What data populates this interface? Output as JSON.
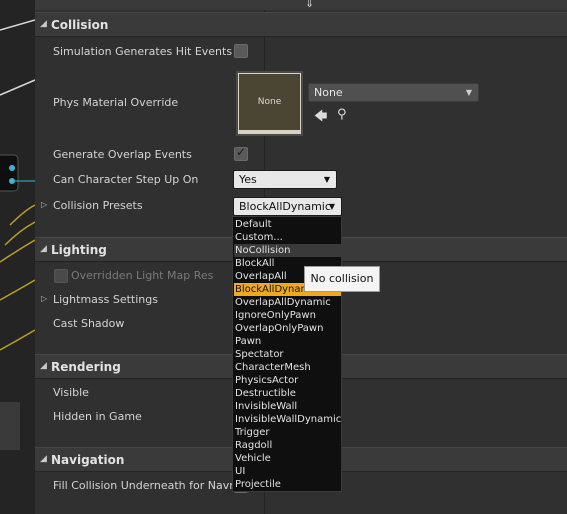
{
  "categories": {
    "collision": "Collision",
    "lighting": "Lighting",
    "rendering": "Rendering",
    "navigation": "Navigation"
  },
  "collision": {
    "sim_hit_events_label": "Simulation Generates Hit Events",
    "phys_material_label": "Phys Material Override",
    "phys_material_thumb_text": "None",
    "phys_material_value": "None",
    "overlap_events_label": "Generate Overlap Events",
    "step_up_label": "Can Character Step Up On",
    "step_up_value": "Yes",
    "presets_label": "Collision Presets",
    "presets_value": "BlockAllDynamic"
  },
  "lighting": {
    "overridden_lightmap_label": "Overridden Light Map Res",
    "lightmass_label": "Lightmass Settings",
    "cast_shadow_label": "Cast Shadow"
  },
  "rendering": {
    "visible_label": "Visible",
    "hidden_label": "Hidden in Game"
  },
  "navigation": {
    "fill_collision_label": "Fill Collision Underneath for Navme"
  },
  "preset_options": [
    "Default",
    "Custom...",
    "NoCollision",
    "BlockAll",
    "OverlapAll",
    "BlockAllDynamic",
    "OverlapAllDynamic",
    "IgnoreOnlyPawn",
    "OverlapOnlyPawn",
    "Pawn",
    "Spectator",
    "CharacterMesh",
    "PhysicsActor",
    "Destructible",
    "InvisibleWall",
    "InvisibleWallDynamic",
    "Trigger",
    "Ragdoll",
    "Vehicle",
    "UI",
    "Projectile"
  ],
  "hovered_option": "NoCollision",
  "selected_option": "BlockAllDynamic",
  "tooltip": "No collision",
  "colors": {
    "panel_bg": "#303030",
    "category_bg": "#3a3a3a",
    "selected_highlight": "#f0a81e",
    "dropdown_bg": "#0f0f0f"
  }
}
